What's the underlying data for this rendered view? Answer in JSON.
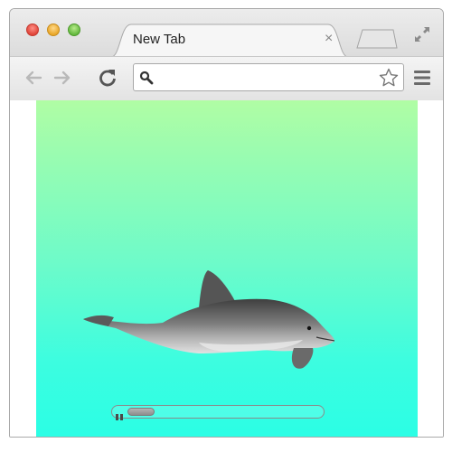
{
  "window": {
    "traffic_lights": [
      "close",
      "minimize",
      "zoom"
    ],
    "fullscreen_icon": "fullscreen-arrows-icon"
  },
  "tab": {
    "title": "New Tab",
    "close_label": "×",
    "new_tab_icon": "new-tab-icon"
  },
  "toolbar": {
    "back_icon": "back-arrow-icon",
    "forward_icon": "forward-arrow-icon",
    "reload_icon": "reload-icon",
    "omnibox": {
      "value": "",
      "icon": "search-icon",
      "bookmark_icon": "star-icon"
    },
    "menu_icon": "hamburger-menu-icon"
  },
  "content": {
    "video": {
      "subject": "dolphin",
      "state": "playing",
      "progress": 0.1,
      "colors": {
        "top": "#b0fda4",
        "bottom": "#2bfee5"
      }
    }
  }
}
